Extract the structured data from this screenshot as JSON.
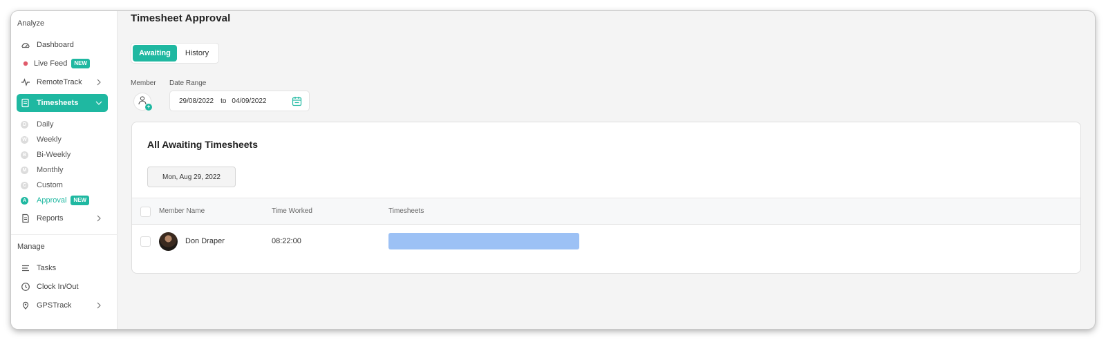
{
  "sidebar": {
    "analyze_label": "Analyze",
    "manage_label": "Manage",
    "items": {
      "dashboard": "Dashboard",
      "live_feed": "Live Feed",
      "live_feed_badge": "NEW",
      "remotetrack": "RemoteTrack",
      "timesheets": "Timesheets",
      "reports": "Reports",
      "tasks": "Tasks",
      "clock": "Clock In/Out",
      "gpstrack": "GPSTrack"
    },
    "sub_items": [
      {
        "letter": "D",
        "label": "Daily"
      },
      {
        "letter": "W",
        "label": "Weekly"
      },
      {
        "letter": "B",
        "label": "Bi-Weekly"
      },
      {
        "letter": "M",
        "label": "Monthly"
      },
      {
        "letter": "C",
        "label": "Custom"
      },
      {
        "letter": "A",
        "label": "Approval",
        "badge": "NEW"
      }
    ],
    "accent_color": "#1fb8a1"
  },
  "main": {
    "title": "Timesheet Approval",
    "tabs": [
      {
        "label": "Awaiting",
        "active": true
      },
      {
        "label": "History",
        "active": false
      }
    ],
    "filters": {
      "member_label": "Member",
      "date_range_label": "Date Range",
      "date_from": "29/08/2022",
      "to_label": "to",
      "date_to": "04/09/2022"
    },
    "card": {
      "title": "All Awaiting Timesheets",
      "date_chip": "Mon, Aug 29, 2022",
      "columns": [
        "Member Name",
        "Time Worked",
        "Timesheets"
      ],
      "rows": [
        {
          "member": "Don Draper",
          "time_worked": "08:22:00",
          "bar_color": "#9cc1f5"
        }
      ]
    }
  }
}
